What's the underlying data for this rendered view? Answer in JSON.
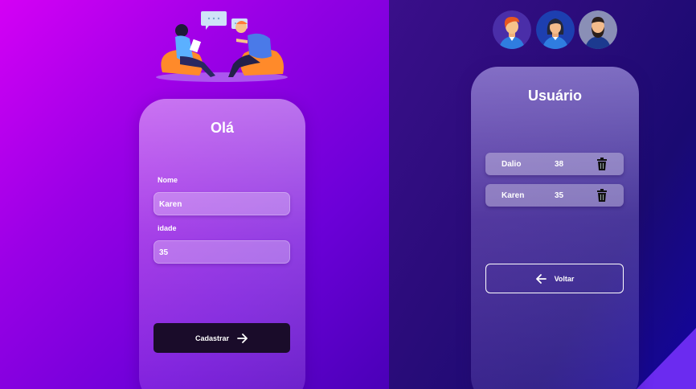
{
  "register_form": {
    "title": "Olá",
    "name_label": "Nome",
    "name_value": "Karen",
    "age_label": "idade",
    "age_value": "35",
    "submit_label": "Cadastrar",
    "submit_icon": "arrow-right-icon"
  },
  "users_panel": {
    "title": "Usuário",
    "avatars": [
      "avatar-man-orange-hair",
      "avatar-woman",
      "avatar-man-beard"
    ],
    "users": [
      {
        "name": "Dalio",
        "age": "38",
        "action_icon": "trash-icon"
      },
      {
        "name": "Karen",
        "age": "35",
        "action_icon": "trash-icon"
      }
    ],
    "back_label": "Voltar",
    "back_icon": "arrow-left-icon"
  },
  "colors": {
    "left_bg_start": "#d400f5",
    "left_bg_end": "#4a00b8",
    "right_bg": "#2a0c7a",
    "button_dark": "#1a0c2a",
    "accent_triangle": "#6b2bf0"
  }
}
